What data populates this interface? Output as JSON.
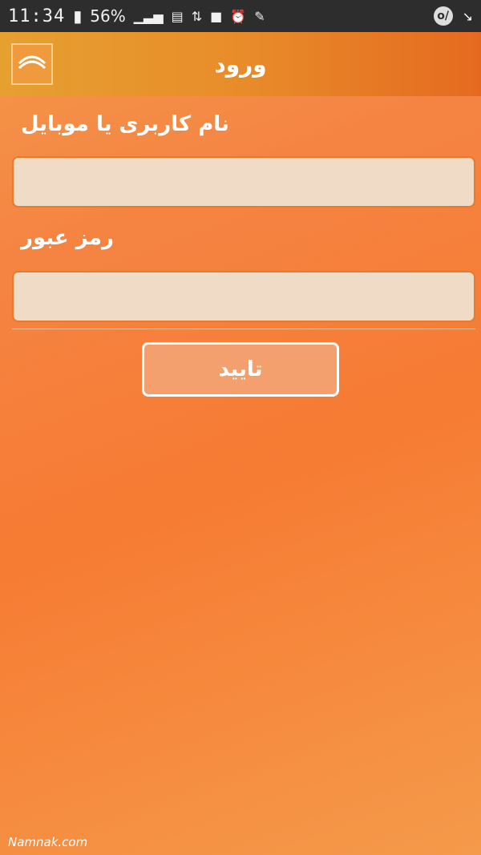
{
  "status_bar": {
    "time": "11:34",
    "battery": "56%",
    "icons": [
      "battery-icon",
      "signal-icon",
      "chart-icon",
      "data-icon",
      "notification-icon",
      "alarm-icon",
      "tools-icon"
    ],
    "right_icon_label": "o/",
    "right_icon2": "↘"
  },
  "header": {
    "title": "ورود",
    "back_icon": "chevron-icon"
  },
  "form": {
    "username_label": "نام کاربری یا موبایل",
    "username_value": "",
    "password_label": "رمز عبور",
    "password_value": "",
    "submit_label": "تایید"
  },
  "watermark": "Namnak.com",
  "colors": {
    "accent": "#e88c2a",
    "status_bg": "#2d2d2d",
    "input_bg": "#f0dcc6"
  }
}
